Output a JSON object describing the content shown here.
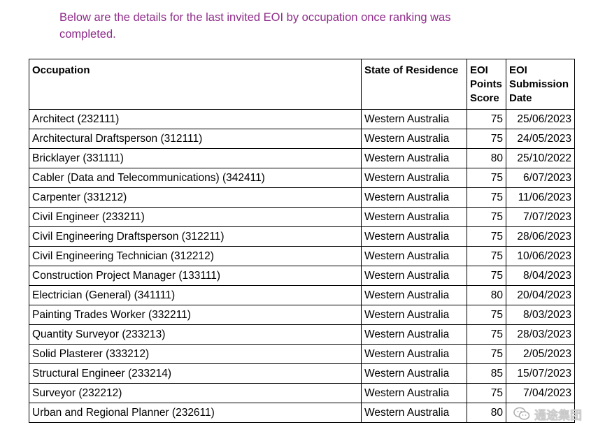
{
  "intro_text": "Below are the details for the last invited EOI by occupation once ranking was completed.",
  "table": {
    "headers": {
      "occupation": "Occupation",
      "state": "State of Residence",
      "points": "EOI Points Score",
      "date": "EOI Submission Date"
    },
    "rows": [
      {
        "occupation": "Architect (232111)",
        "state": "Western Australia",
        "points": "75",
        "date": "25/06/2023"
      },
      {
        "occupation": "Architectural Draftsperson (312111)",
        "state": "Western Australia",
        "points": "75",
        "date": "24/05/2023"
      },
      {
        "occupation": "Bricklayer (331111)",
        "state": "Western Australia",
        "points": "80",
        "date": "25/10/2022"
      },
      {
        "occupation": "Cabler (Data and Telecommunications) (342411)",
        "state": "Western Australia",
        "points": "75",
        "date": "6/07/2023"
      },
      {
        "occupation": "Carpenter (331212)",
        "state": "Western Australia",
        "points": "75",
        "date": "11/06/2023"
      },
      {
        "occupation": "Civil Engineer (233211)",
        "state": "Western Australia",
        "points": "75",
        "date": "7/07/2023"
      },
      {
        "occupation": "Civil Engineering Draftsperson (312211)",
        "state": "Western Australia",
        "points": "75",
        "date": "28/06/2023"
      },
      {
        "occupation": "Civil Engineering Technician (312212)",
        "state": "Western Australia",
        "points": "75",
        "date": "10/06/2023"
      },
      {
        "occupation": "Construction Project Manager (133111)",
        "state": "Western Australia",
        "points": "75",
        "date": "8/04/2023"
      },
      {
        "occupation": "Electrician (General) (341111)",
        "state": "Western Australia",
        "points": "80",
        "date": "20/04/2023"
      },
      {
        "occupation": "Painting Trades Worker (332211)",
        "state": "Western Australia",
        "points": "75",
        "date": "8/03/2023"
      },
      {
        "occupation": "Quantity Surveyor (233213)",
        "state": "Western Australia",
        "points": "75",
        "date": "28/03/2023"
      },
      {
        "occupation": "Solid Plasterer (333212)",
        "state": "Western Australia",
        "points": "75",
        "date": "2/05/2023"
      },
      {
        "occupation": "Structural Engineer (233214)",
        "state": "Western Australia",
        "points": "85",
        "date": "15/07/2023"
      },
      {
        "occupation": "Surveyor (232212)",
        "state": "Western Australia",
        "points": "75",
        "date": "7/04/2023"
      },
      {
        "occupation": "Urban and Regional Planner (232611)",
        "state": "Western Australia",
        "points": "80",
        "date": ""
      }
    ]
  },
  "watermark": {
    "icon": "wechat-icon",
    "text": "通途集团"
  }
}
